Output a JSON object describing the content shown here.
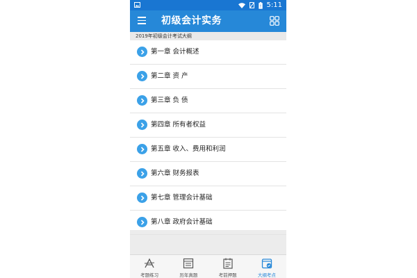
{
  "status_bar": {
    "time": "5:11"
  },
  "toolbar": {
    "title": "初级会计实务",
    "menu_icon": "menu-icon",
    "grid_icon": "grid-icon"
  },
  "subheader": {
    "text": "2019年初级会计考试大纲"
  },
  "chapters": [
    {
      "label": "第一章  会计概述"
    },
    {
      "label": "第二章  资  产"
    },
    {
      "label": "第三章  负  债"
    },
    {
      "label": "第四章  所有者权益"
    },
    {
      "label": "第五章  收入、费用和利润"
    },
    {
      "label": "第六章  财务报表"
    },
    {
      "label": "第七章  管理会计基础"
    },
    {
      "label": "第八章  政府会计基础"
    }
  ],
  "bottom_tabs": [
    {
      "label": "考题练习",
      "icon": "practice-icon"
    },
    {
      "label": "历年真题",
      "icon": "past-papers-icon"
    },
    {
      "label": "考前押题",
      "icon": "mock-exam-icon"
    },
    {
      "label": "大纲考点",
      "icon": "syllabus-icon",
      "active": true
    }
  ],
  "colors": {
    "status_bar": "#1976d2",
    "toolbar": "#2688d8",
    "chevron": "#3ba1e8",
    "active_tab": "#2688d8"
  }
}
